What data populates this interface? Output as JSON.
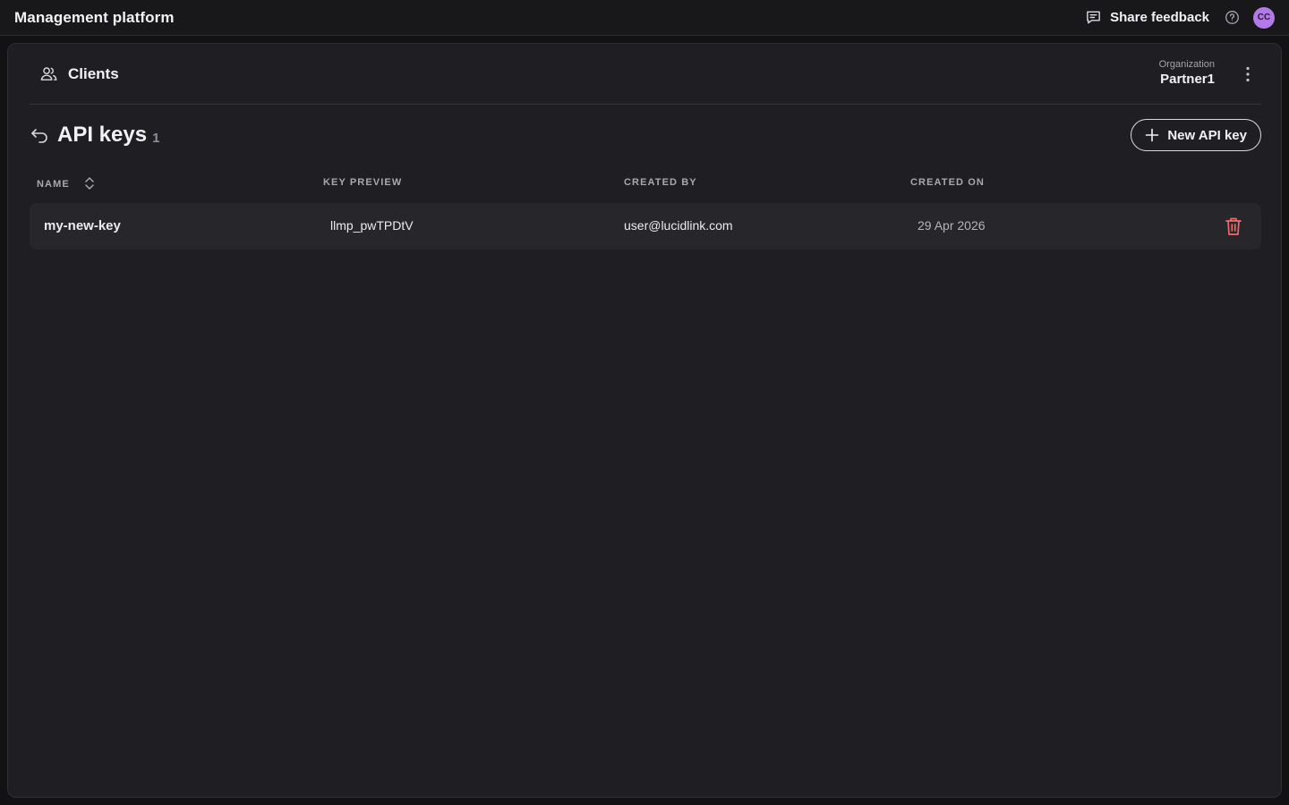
{
  "app": {
    "title": "Management platform"
  },
  "topbar": {
    "feedback_label": "Share feedback",
    "help_icon": "help-circle-icon",
    "avatar_initials": "CC",
    "avatar_color": "#b27ae6"
  },
  "header": {
    "section_icon": "users-icon",
    "section_label": "Clients",
    "org_label": "Organization",
    "org_value": "Partner1"
  },
  "page": {
    "title": "API keys",
    "count": "1",
    "new_button_label": "New API key"
  },
  "table": {
    "columns": [
      "NAME",
      "KEY PREVIEW",
      "CREATED BY",
      "CREATED ON"
    ],
    "rows": [
      {
        "name": "my-new-key",
        "key_preview": "llmp_pwTPDtV",
        "created_by": "user@lucidlink.com",
        "created_on": "29 Apr 2026"
      }
    ]
  },
  "colors": {
    "background": "#121214",
    "panel": "#1f1f23",
    "row": "#26262b",
    "danger": "#ef6b6b"
  }
}
